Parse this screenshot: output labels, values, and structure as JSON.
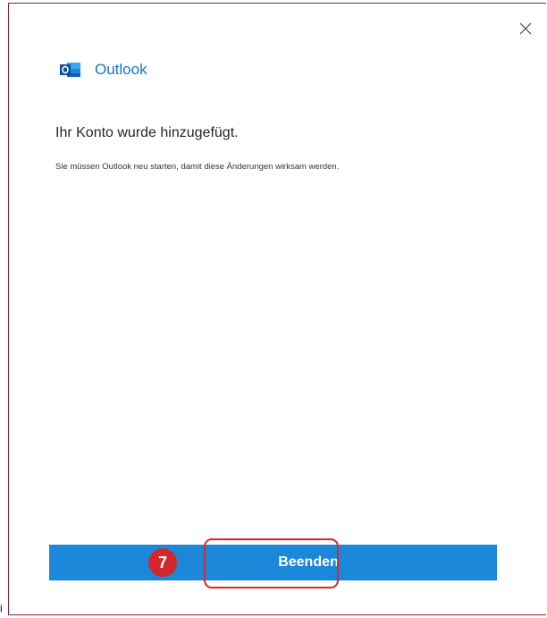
{
  "dialog": {
    "close_icon": "close-icon",
    "brand": {
      "icon": "outlook-logo-icon",
      "name": "Outlook",
      "accent_color": "#1a73c9"
    },
    "heading": "Ihr Konto wurde hinzugefügt.",
    "message": "Sie müssen Outlook neu starten, damit diese Änderungen wirksam werden.",
    "finish_button": {
      "label": "Beenden",
      "color": "#1b87d9"
    }
  },
  "annotation": {
    "step_number": "7",
    "highlight_color": "#d42a2a"
  },
  "stray_glyph": "i"
}
